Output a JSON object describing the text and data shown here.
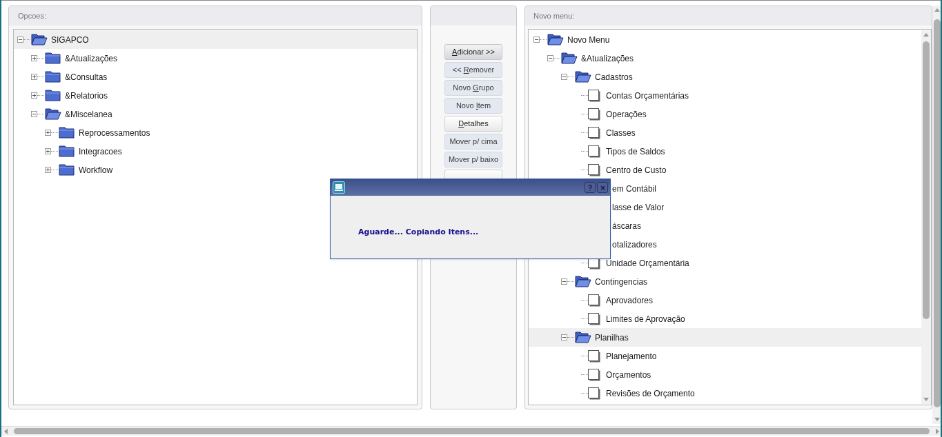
{
  "panels": {
    "options": {
      "title": "Opcoes:",
      "tree": [
        {
          "kind": "folder",
          "label": "SIGAPCO",
          "expanded": true,
          "selected": true,
          "children": [
            {
              "kind": "folder",
              "label": "&Atualizações",
              "expanded": false,
              "selected": false
            },
            {
              "kind": "folder",
              "label": "&Consultas",
              "expanded": false,
              "selected": false
            },
            {
              "kind": "folder",
              "label": "&Relatorios",
              "expanded": false,
              "selected": false
            },
            {
              "kind": "folder",
              "label": "&Miscelanea",
              "expanded": true,
              "selected": false,
              "children": [
                {
                  "kind": "folder",
                  "label": "Reprocessamentos",
                  "expanded": false,
                  "selected": false
                },
                {
                  "kind": "folder",
                  "label": "Integracoes",
                  "expanded": false,
                  "selected": false
                },
                {
                  "kind": "folder",
                  "label": "Workflow",
                  "expanded": false,
                  "selected": false
                }
              ]
            }
          ]
        }
      ]
    },
    "actions": [
      {
        "key": "A",
        "after": "dicionar >>",
        "focused": true,
        "disabled": false
      },
      {
        "before": "<< ",
        "key": "R",
        "after": "emover",
        "focused": false,
        "disabled": true
      },
      {
        "before": "Novo ",
        "key": "G",
        "after": "rupo",
        "focused": false,
        "disabled": true
      },
      {
        "before": "Novo ",
        "key": "I",
        "after": "tem",
        "focused": false,
        "disabled": true
      },
      {
        "key": "D",
        "after": "etalhes",
        "focused": false,
        "disabled": false
      },
      {
        "before": "Mover p/ cima",
        "focused": false,
        "disabled": true
      },
      {
        "before": "Mover p/ baixo",
        "focused": false,
        "disabled": true
      },
      {
        "focused": false,
        "disabled": false
      }
    ],
    "new_menu": {
      "title": "Novo menu:",
      "tree": [
        {
          "kind": "folder",
          "label": "Novo Menu",
          "expanded": true,
          "selected": false,
          "children": [
            {
              "kind": "folder",
              "label": "&Atualizações",
              "expanded": true,
              "selected": false,
              "children": [
                {
                  "kind": "folder",
                  "label": "Cadastros",
                  "expanded": true,
                  "selected": false,
                  "children": [
                    {
                      "kind": "item",
                      "label": "Contas Orçamentárias",
                      "selected": false
                    },
                    {
                      "kind": "item",
                      "label": "Operações",
                      "selected": false
                    },
                    {
                      "kind": "item",
                      "label": "Classes",
                      "selected": false
                    },
                    {
                      "kind": "item",
                      "label": "Tipos de Saldos",
                      "selected": false
                    },
                    {
                      "kind": "item",
                      "label": "Centro de Custo",
                      "selected": false
                    },
                    {
                      "kind": "covered",
                      "label": "em Contábil",
                      "selected": false
                    },
                    {
                      "kind": "covered",
                      "label": "lasse de Valor",
                      "selected": false
                    },
                    {
                      "kind": "covered",
                      "label": "áscaras",
                      "selected": false
                    },
                    {
                      "kind": "covered",
                      "label": "otalizadores",
                      "selected": false
                    },
                    {
                      "kind": "item",
                      "label": "Unidade Orçamentária",
                      "selected": false
                    }
                  ]
                },
                {
                  "kind": "folder",
                  "label": "Contingencias",
                  "expanded": true,
                  "selected": false,
                  "children": [
                    {
                      "kind": "item",
                      "label": "Aprovadores",
                      "selected": false
                    },
                    {
                      "kind": "item",
                      "label": "Limites de Aprovação",
                      "selected": false
                    }
                  ]
                },
                {
                  "kind": "folder",
                  "label": "Planilhas",
                  "expanded": true,
                  "selected": true,
                  "children": [
                    {
                      "kind": "item",
                      "label": "Planejamento",
                      "selected": false
                    },
                    {
                      "kind": "item",
                      "label": "Orçamentos",
                      "selected": false
                    },
                    {
                      "kind": "item",
                      "label": "Revisões de Orçamento",
                      "selected": false
                    }
                  ]
                }
              ]
            }
          ]
        }
      ]
    }
  },
  "dialog": {
    "message": "Aguarde... Copiando Itens..."
  }
}
